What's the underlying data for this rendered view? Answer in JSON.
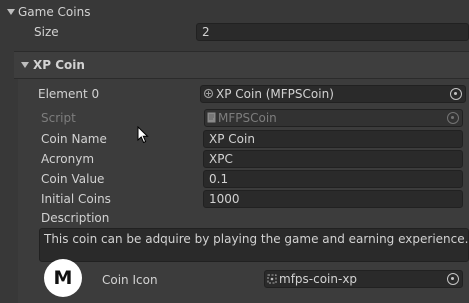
{
  "game_coins": {
    "label": "Game Coins",
    "size_label": "Size",
    "size_value": "2"
  },
  "xp_coin": {
    "header": "XP Coin",
    "element0_label": "Element 0",
    "element0_value": "XP Coin (MFPSCoin)",
    "script_label": "Script",
    "script_value": "MFPSCoin",
    "coin_name_label": "Coin Name",
    "coin_name_value": "XP Coin",
    "acronym_label": "Acronym",
    "acronym_value": "XPC",
    "coin_value_label": "Coin Value",
    "coin_value_value": "0.1",
    "initial_coins_label": "Initial Coins",
    "initial_coins_value": "1000",
    "description_label": "Description",
    "description_value": "This coin can be adquire by playing the game and earning experience.",
    "coin_icon_label": "Coin Icon",
    "coin_icon_value": "mfps-coin-xp",
    "icon_letter": "M"
  },
  "icons": {
    "foldout": "triangle-down-icon",
    "object_picker": "object-picker-icon",
    "script_asset": "script-file-icon",
    "scriptable_object": "scriptable-object-icon",
    "sprite": "sprite-icon",
    "cursor": "mouse-pointer-icon"
  },
  "colors": {
    "background": "#383838",
    "field": "#2a2a2a",
    "text": "#d2d2d2",
    "disabled_text": "#7d7d7d"
  }
}
